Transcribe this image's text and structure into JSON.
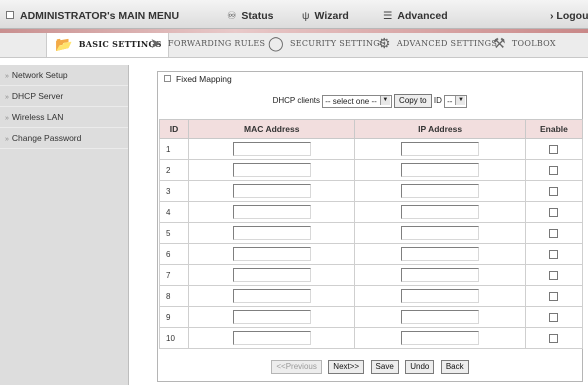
{
  "topbar": {
    "main_menu": "ADMINISTRATOR's MAIN MENU",
    "status": "Status",
    "wizard": "Wizard",
    "advanced": "Advanced",
    "logout": "Logout",
    "logout_prefix": "›"
  },
  "tabs": [
    {
      "label": "BASIC SETTINGS",
      "icon": "folder-icon"
    },
    {
      "label": "FORWARDING RULES",
      "icon": "forward-icon"
    },
    {
      "label": "SECURITY SETTINGS",
      "icon": "security-icon"
    },
    {
      "label": "ADVANCED SETTINGS",
      "icon": "advanced-icon"
    },
    {
      "label": "TOOLBOX",
      "icon": "toolbox-icon"
    }
  ],
  "sidebar": {
    "items": [
      {
        "label": "Network Setup"
      },
      {
        "label": "DHCP Server"
      },
      {
        "label": "Wireless LAN"
      },
      {
        "label": "Change Password"
      }
    ]
  },
  "panel": {
    "title": "Fixed Mapping",
    "dhcp_label": "DHCP clients",
    "dhcp_select_value": "-- select one --",
    "copy_button": "Copy to",
    "id_label": "ID",
    "id_select_value": "--"
  },
  "table": {
    "headers": [
      "ID",
      "MAC Address",
      "IP Address",
      "Enable"
    ],
    "rows": [
      {
        "id": "1",
        "mac": "",
        "ip": "",
        "enabled": false
      },
      {
        "id": "2",
        "mac": "",
        "ip": "",
        "enabled": false
      },
      {
        "id": "3",
        "mac": "",
        "ip": "",
        "enabled": false
      },
      {
        "id": "4",
        "mac": "",
        "ip": "",
        "enabled": false
      },
      {
        "id": "5",
        "mac": "",
        "ip": "",
        "enabled": false
      },
      {
        "id": "6",
        "mac": "",
        "ip": "",
        "enabled": false
      },
      {
        "id": "7",
        "mac": "",
        "ip": "",
        "enabled": false
      },
      {
        "id": "8",
        "mac": "",
        "ip": "",
        "enabled": false
      },
      {
        "id": "9",
        "mac": "",
        "ip": "",
        "enabled": false
      },
      {
        "id": "10",
        "mac": "",
        "ip": "",
        "enabled": false
      }
    ]
  },
  "buttons": {
    "previous": "<<Previous",
    "next": "Next>>",
    "save": "Save",
    "undo": "Undo",
    "back": "Back"
  },
  "colors": {
    "header_pink": "#f2dede",
    "accent_strip": "#d9a7a7",
    "sidebar_bg": "#dddddd"
  }
}
